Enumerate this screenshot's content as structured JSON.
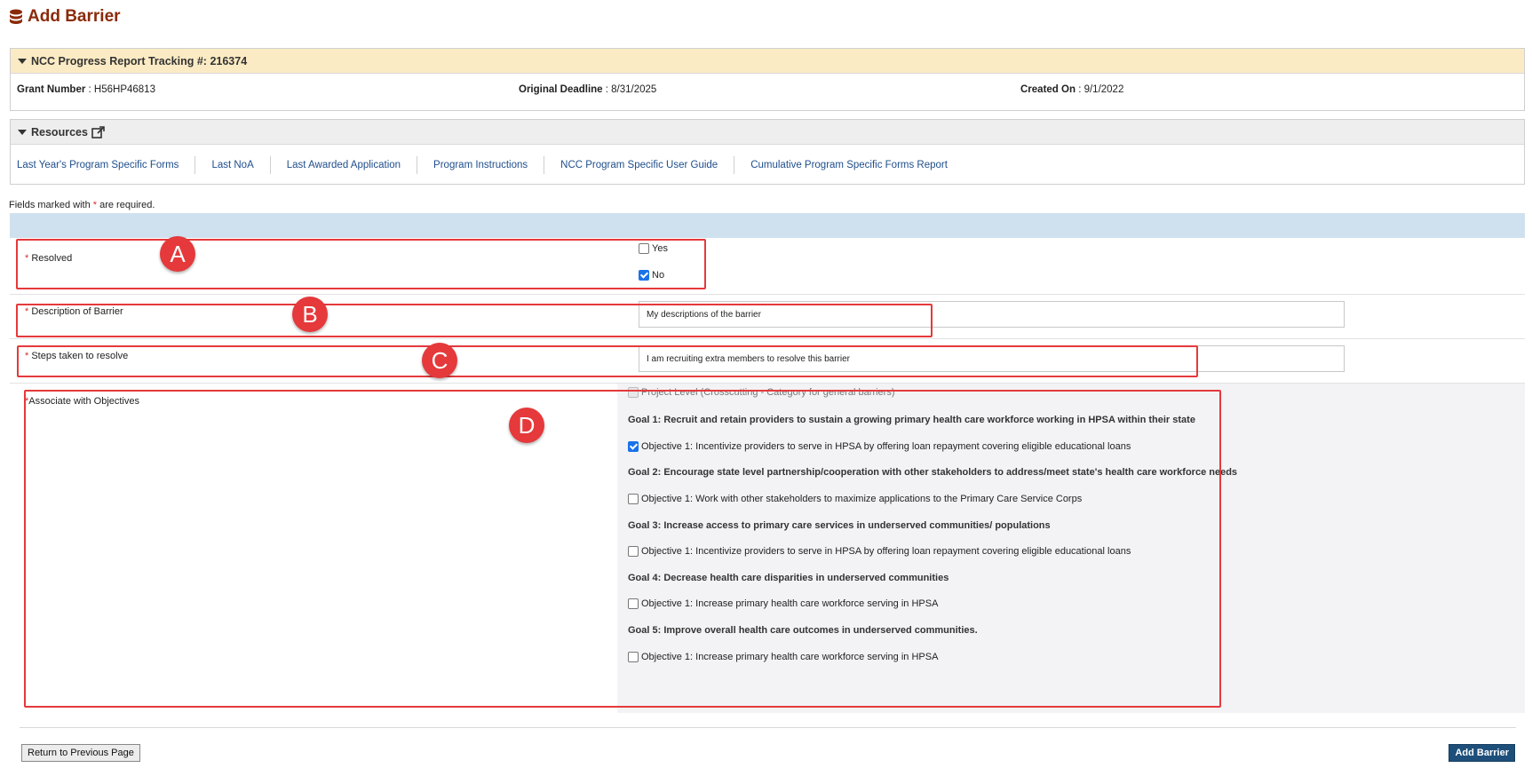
{
  "page": {
    "title": "Add Barrier"
  },
  "tracking": {
    "header": "NCC Progress Report Tracking #: 216374",
    "grant_label": "Grant Number",
    "grant_value": " : H56HP46813",
    "deadline_label": "Original Deadline",
    "deadline_value": " : 8/31/2025",
    "created_label": "Created On",
    "created_value": " : 9/1/2022"
  },
  "resources": {
    "header": "Resources",
    "links": [
      "Last Year's Program Specific Forms",
      "Last NoA",
      "Last Awarded Application",
      "Program Instructions",
      "NCC Program Specific User Guide",
      "Cumulative Program Specific Forms Report"
    ]
  },
  "form": {
    "required_prefix": "Fields marked with ",
    "required_star": "*",
    "required_suffix": " are required.",
    "resolved_label": "Resolved",
    "resolved_options": [
      {
        "label": "Yes",
        "checked": false
      },
      {
        "label": "No",
        "checked": true
      }
    ],
    "description_label": "Description of Barrier",
    "description_value": "My descriptions of the barrier",
    "steps_label": "Steps taken to resolve",
    "steps_value": "I am recruiting extra members to resolve this barrier",
    "objectives_label": "Associate with Objectives",
    "project_level": "Project Level (Crosscutting - Category for general barriers)",
    "goals": [
      {
        "title": "Goal 1: Recruit and retain providers to sustain a growing primary health care workforce working in HPSA within their state",
        "objective": "Objective 1: Incentivize providers to serve in HPSA by offering loan repayment covering eligible educational loans",
        "checked": true
      },
      {
        "title": "Goal 2: Encourage state level partnership/cooperation with other stakeholders to address/meet state's health care workforce needs",
        "objective": "Objective 1: Work with other stakeholders to maximize applications to the Primary Care Service Corps",
        "checked": false
      },
      {
        "title": "Goal 3: Increase access to primary care services in underserved communities/ populations",
        "objective": "Objective 1: Incentivize providers to serve in HPSA by offering loan repayment covering eligible educational loans",
        "checked": false
      },
      {
        "title": "Goal 4: Decrease health care disparities in underserved communities",
        "objective": "Objective 1: Increase primary health care workforce serving in HPSA",
        "checked": false
      },
      {
        "title": "Goal 5: Improve overall health care outcomes in underserved communities.",
        "objective": "Objective 1: Increase primary health care workforce serving in HPSA",
        "checked": false
      }
    ]
  },
  "buttons": {
    "return": "Return to Previous Page",
    "add": "Add Barrier"
  },
  "annotations": [
    "A",
    "B",
    "C",
    "D"
  ],
  "colors": {
    "title": "#8a2a0a",
    "accent": "#e5393b",
    "link": "#1f4e8c",
    "primary_button": "#1d4f7a"
  }
}
